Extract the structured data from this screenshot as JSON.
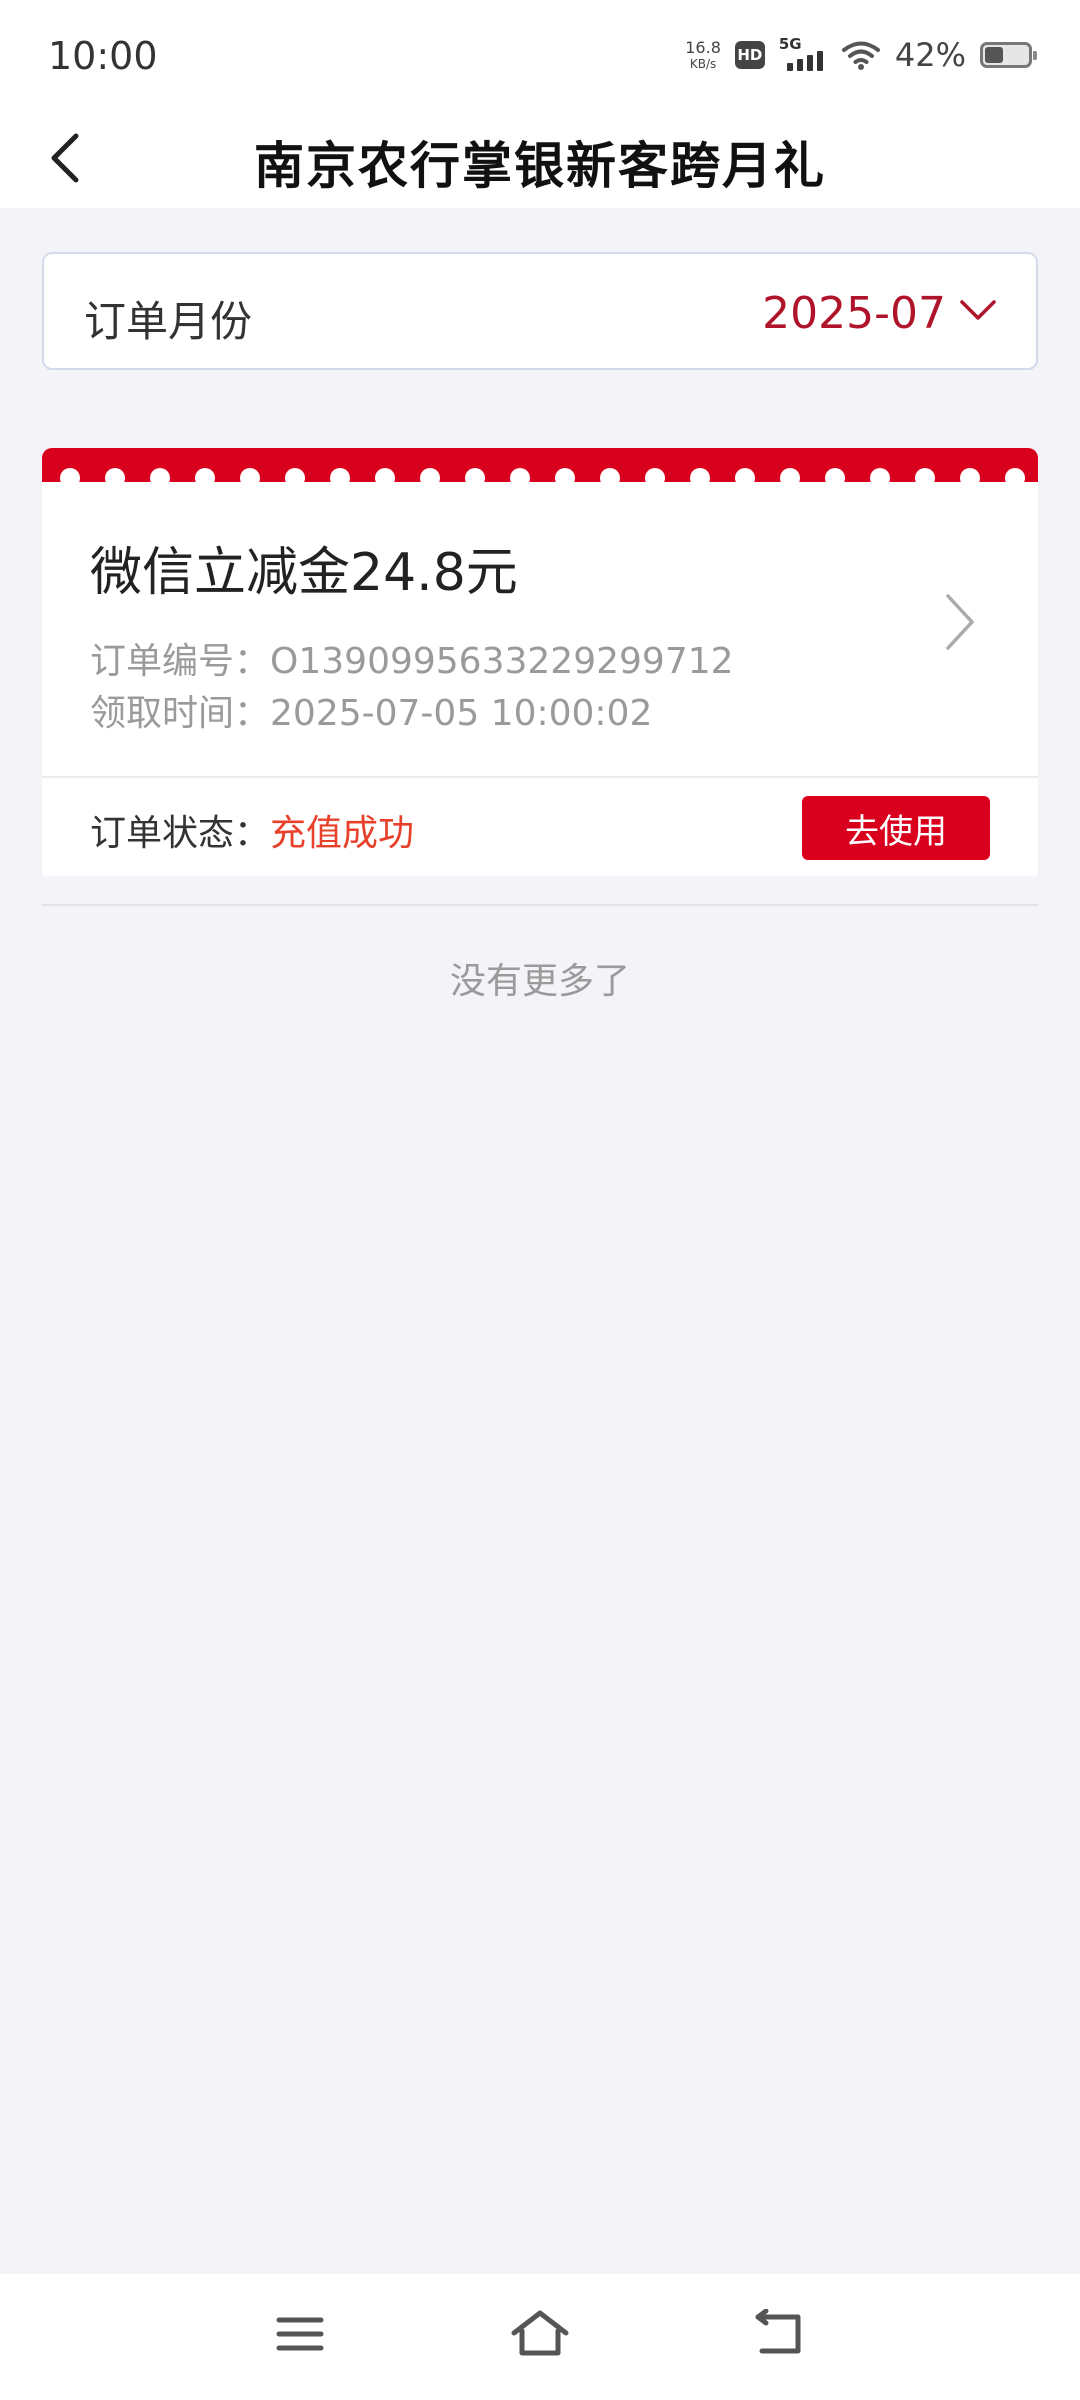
{
  "status_bar": {
    "time": "10:00",
    "net_speed_value": "16.8",
    "net_speed_unit": "KB/s",
    "hd_label": "HD",
    "network_label": "5G",
    "battery_percent": "42%",
    "battery_level": 0.42
  },
  "header": {
    "back_icon": "chevron-left-icon",
    "title": "南京农行掌银新客跨月礼"
  },
  "month_selector": {
    "label": "订单月份",
    "value": "2025-07",
    "icon": "chevron-down-icon"
  },
  "orders": [
    {
      "title": "微信立减金24.8元",
      "order_number_label": "订单编号：",
      "order_number": "O1390995633229299712",
      "claim_time_label": "领取时间：",
      "claim_time": "2025-07-05 10:00:02",
      "status_label": "订单状态：",
      "status": "充值成功",
      "action_label": "去使用"
    }
  ],
  "list_end_text": "没有更多了",
  "nav_bar": {
    "menu_icon": "menu-icon",
    "home_icon": "home-icon",
    "back_icon": "back-icon"
  },
  "colors": {
    "brand_red": "#d8001c",
    "month_red": "#b0142a",
    "status_orange": "#e8402a",
    "page_background": "#f3f3f8"
  }
}
